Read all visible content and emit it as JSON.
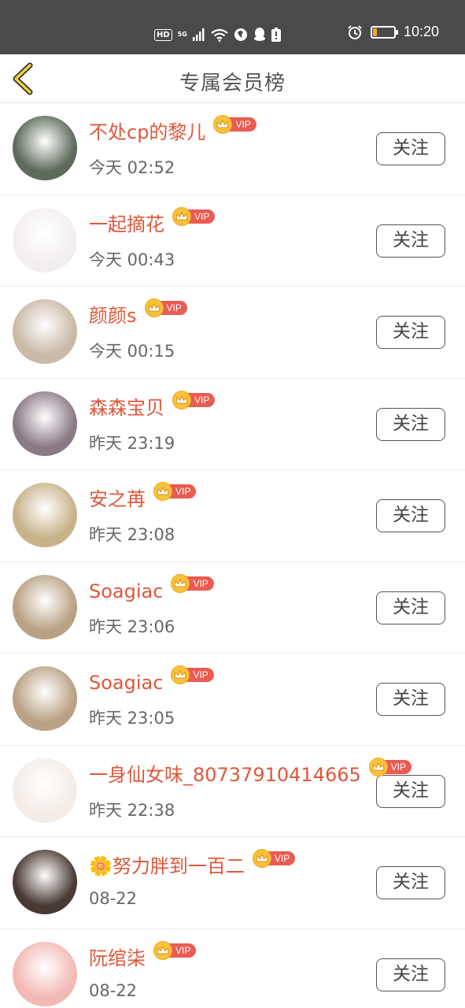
{
  "status_bar": {
    "hd": "HD",
    "network": "5G",
    "time": "10:20",
    "battery_level": 0.2
  },
  "nav": {
    "title": "专属会员榜"
  },
  "vip_label": "VIP",
  "follow_label": "关注",
  "members": [
    {
      "name": "不处cp的黎儿",
      "time": "今天 02:52",
      "avatar_color": "#5d6b5a"
    },
    {
      "name": "一起摘花",
      "time": "今天 00:43",
      "avatar_color": "#f3eef2"
    },
    {
      "name": "颜颜s",
      "time": "今天 00:15",
      "avatar_color": "#c9b9a6"
    },
    {
      "name": "森森宝贝",
      "time": "昨天 23:19",
      "avatar_color": "#8a7a86"
    },
    {
      "name": "安之苒",
      "time": "昨天 23:08",
      "avatar_color": "#c8b28a"
    },
    {
      "name": "Soagiac",
      "time": "昨天 23:06",
      "avatar_color": "#b9a183"
    },
    {
      "name": "Soagiac",
      "time": "昨天 23:05",
      "avatar_color": "#b9a183"
    },
    {
      "name": "一身仙女味_80737910414665",
      "time": "昨天 22:38",
      "avatar_color": "#f4ece6"
    },
    {
      "name": "🌼努力胖到一百二",
      "time": "08-22",
      "avatar_color": "#4a3a34"
    },
    {
      "name": "阮绾柒",
      "time": "08-22",
      "avatar_color": "#f2b9b4"
    }
  ]
}
